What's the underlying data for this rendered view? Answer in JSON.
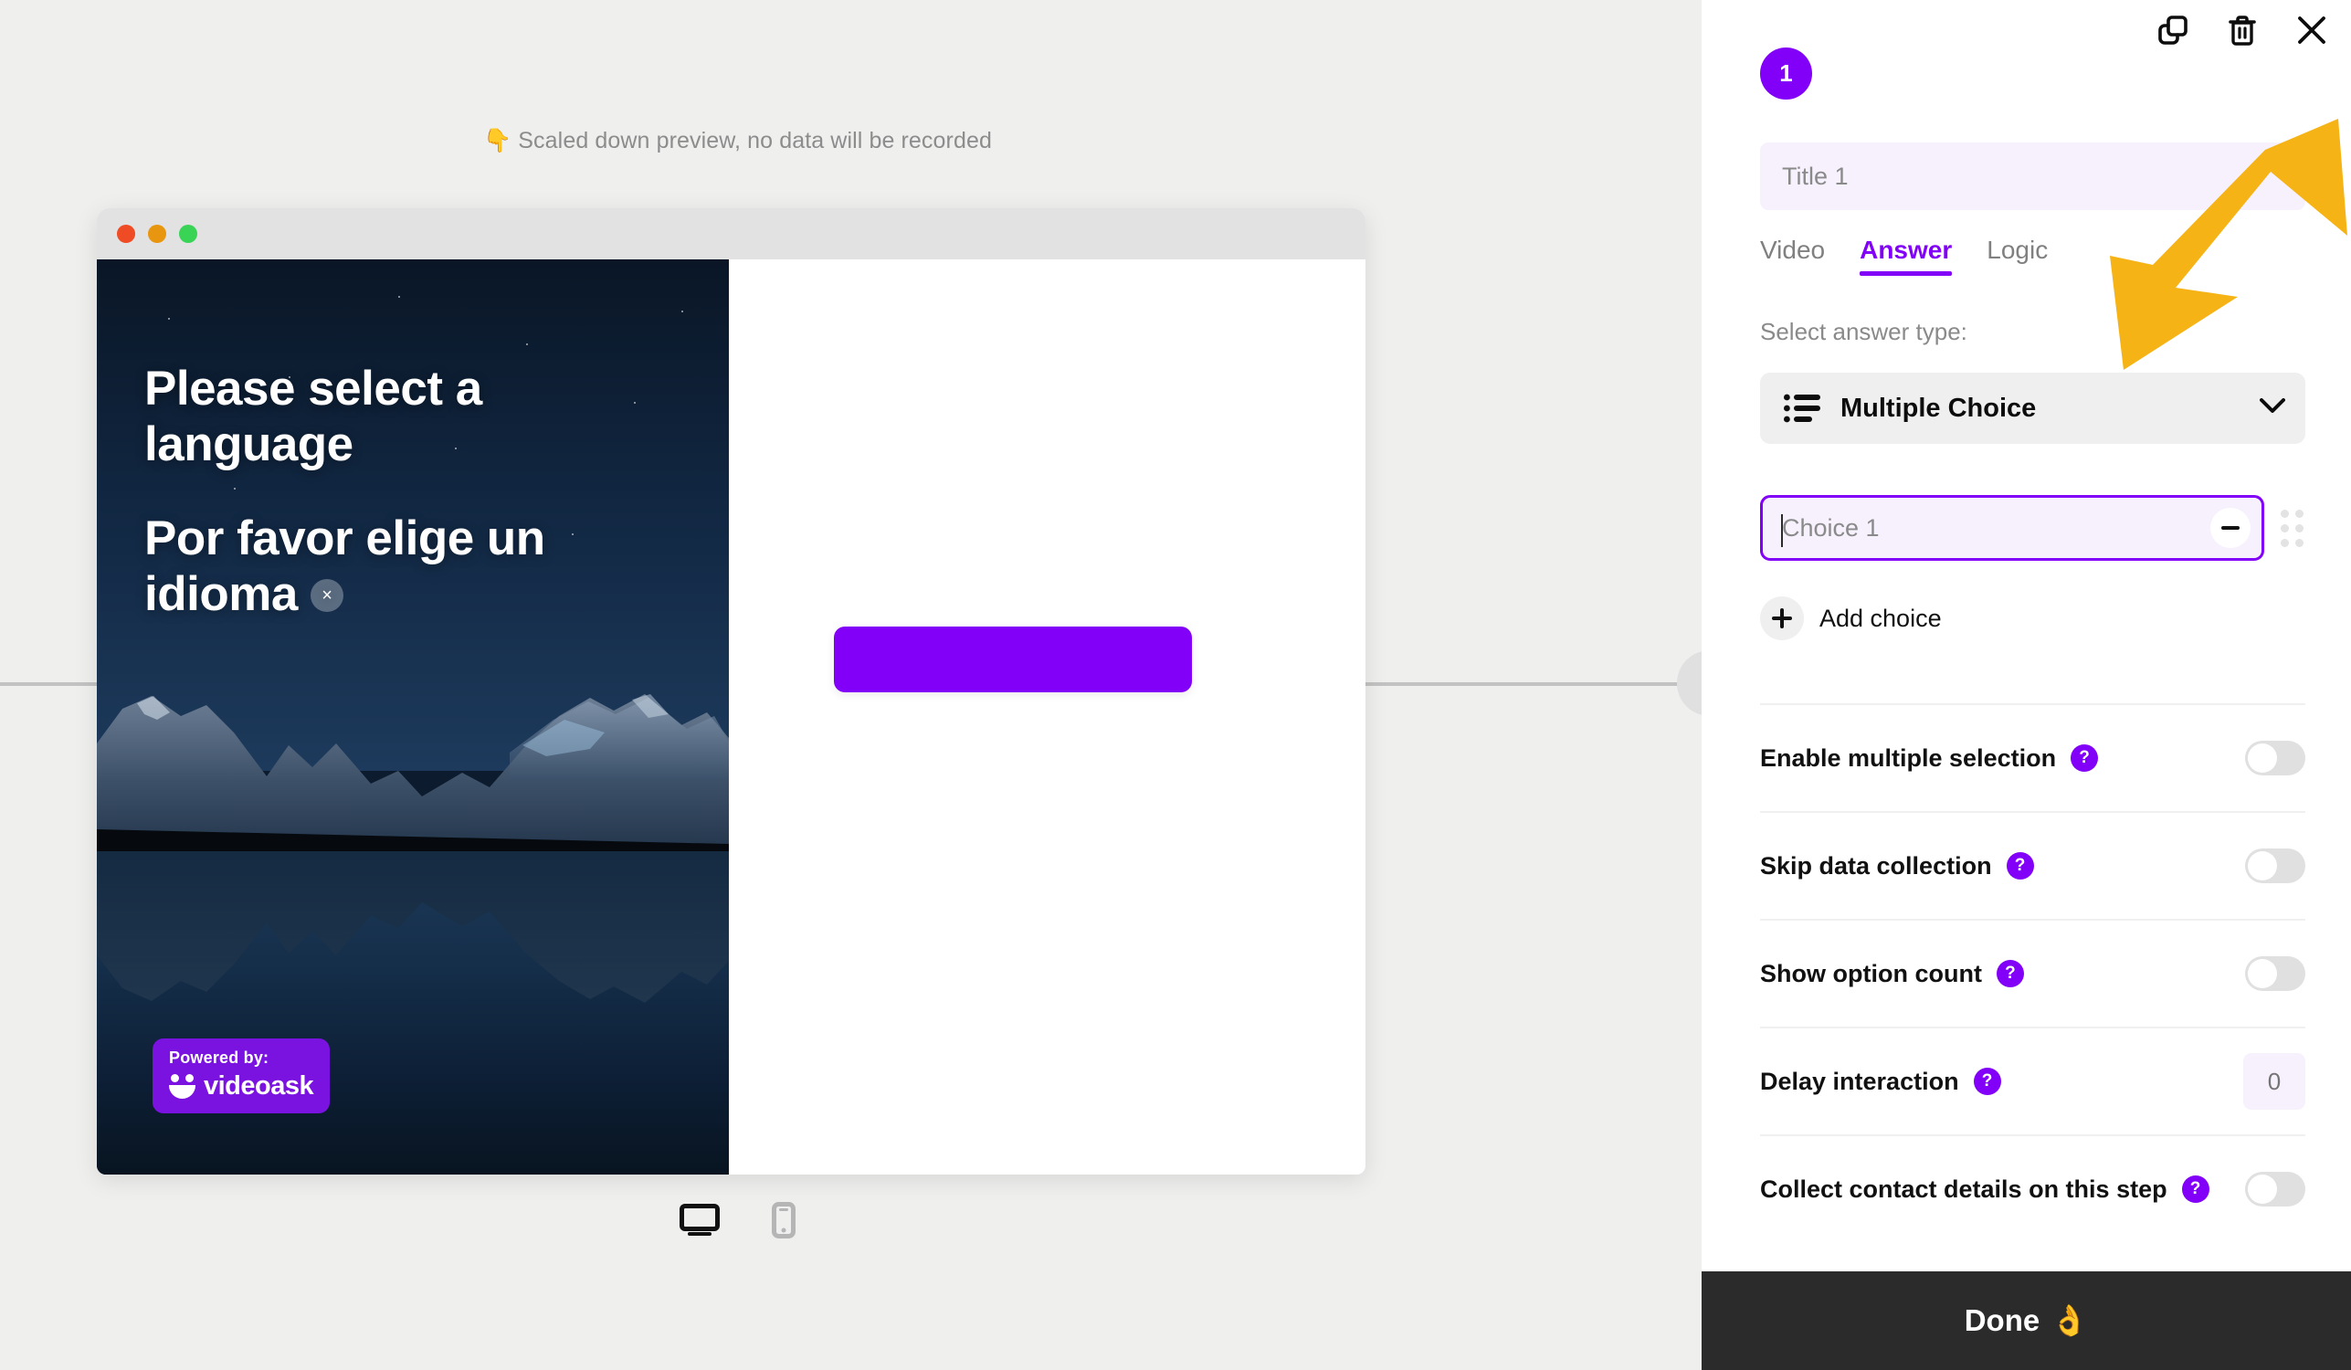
{
  "canvas": {
    "preview_banner": "Scaled down preview, no data will be recorded",
    "preview_banner_emoji": "👇"
  },
  "browser_preview": {
    "traffic_lights": [
      "close",
      "minimize",
      "maximize"
    ],
    "overlay_caption_line1": "Please select a language",
    "overlay_caption_line2": "Por favor elige un idioma",
    "caption_close_glyph": "×",
    "powered_by_label": "Powered by:",
    "brand_name": "videoask",
    "cta_button_label": ""
  },
  "device_toggle": {
    "desktop_icon": "monitor-icon",
    "mobile_icon": "phone-icon",
    "selected": "desktop"
  },
  "side_panel": {
    "topbar": {
      "duplicate_icon": "duplicate-icon",
      "delete_icon": "trash-icon",
      "close_icon": "close-icon"
    },
    "step_number": "1",
    "title": {
      "value": "",
      "placeholder": "Title 1"
    },
    "tabs": [
      {
        "label": "Video",
        "active": false
      },
      {
        "label": "Answer",
        "active": true
      },
      {
        "label": "Logic",
        "active": false
      }
    ],
    "answer_type": {
      "section_label": "Select answer type:",
      "selected": "Multiple Choice",
      "icon": "bulleted-list-icon",
      "caret_icon": "chevron-down-icon"
    },
    "choices": [
      {
        "value": "",
        "placeholder": "Choice 1",
        "remove_icon": "minus-icon",
        "drag_icon": "drag-handle-icon"
      }
    ],
    "add_choice_label": "Add choice",
    "add_choice_icon": "plus-icon",
    "settings": [
      {
        "label": "Enable multiple selection",
        "help": "?",
        "control": "toggle",
        "value": "off"
      },
      {
        "label": "Skip data collection",
        "help": "?",
        "control": "toggle",
        "value": "off"
      },
      {
        "label": "Show option count",
        "help": "?",
        "control": "toggle",
        "value": "off"
      },
      {
        "label": "Delay interaction",
        "help": "?",
        "control": "number",
        "value": "0",
        "placeholder": "0"
      },
      {
        "label": "Collect contact details on this step",
        "help": "?",
        "control": "toggle",
        "value": "off"
      }
    ],
    "done_label": "Done",
    "done_emoji": "👌"
  },
  "annotation": {
    "arrow_color": "#F5B315",
    "points_at": "answer-type-select"
  },
  "colors": {
    "brand_purple": "#8200F7",
    "canvas_bg": "#EFEFEE",
    "panel_bg": "#FFFFFF",
    "done_bar_bg": "#2B2B2B",
    "annotation_yellow": "#F5B315",
    "field_tint": "#F7F1FE"
  }
}
